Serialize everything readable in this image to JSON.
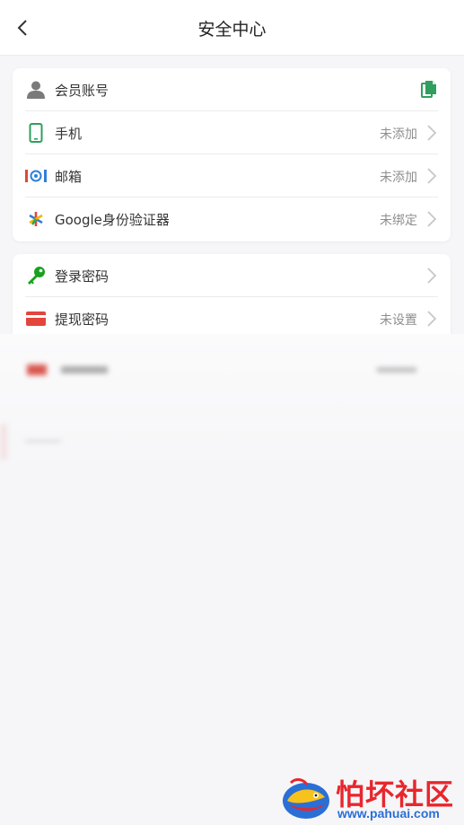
{
  "header": {
    "title": "安全中心"
  },
  "account_card": {
    "items": [
      {
        "label": "会员账号",
        "icon": "user-icon"
      },
      {
        "label": "手机",
        "status": "未添加",
        "icon": "phone-icon"
      },
      {
        "label": "邮箱",
        "status": "未添加",
        "icon": "email-icon"
      },
      {
        "label": "Google身份验证器",
        "status": "未绑定",
        "icon": "google-authenticator-icon"
      }
    ],
    "copy_icon": "copy-icon"
  },
  "password_card": {
    "items": [
      {
        "label": "登录密码",
        "icon": "key-icon"
      },
      {
        "label": "提现密码",
        "status": "未设置",
        "icon": "card-icon"
      }
    ]
  },
  "watermark": {
    "name": "怕坏社区",
    "url": "www.pahuai.com"
  },
  "colors": {
    "accent_green": "#2f9e5e",
    "key_green": "#1aa01e",
    "card_red": "#e2463b",
    "email_blue": "#2f7fd8"
  }
}
